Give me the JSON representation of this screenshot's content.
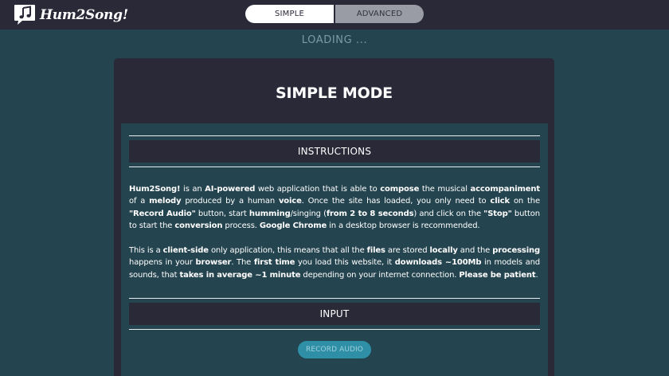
{
  "header": {
    "logo_text": "Hum2Song!",
    "tabs": [
      "SIMPLE",
      "ADVANCED"
    ],
    "active_tab": "SIMPLE"
  },
  "status": {
    "loading_text": "LOADING ..."
  },
  "card": {
    "title": "SIMPLE MODE",
    "instructions_heading": "INSTRUCTIONS",
    "paragraph1": [
      {
        "t": "Hum2Song!",
        "b": true
      },
      {
        "t": " is an ",
        "b": false
      },
      {
        "t": "AI-powered",
        "b": true
      },
      {
        "t": " web application that is able to ",
        "b": false
      },
      {
        "t": "compose",
        "b": true
      },
      {
        "t": " the musical ",
        "b": false
      },
      {
        "t": "accompaniment",
        "b": true
      },
      {
        "t": " of a ",
        "b": false
      },
      {
        "t": "melody",
        "b": true
      },
      {
        "t": " produced by a human ",
        "b": false
      },
      {
        "t": "voice",
        "b": true
      },
      {
        "t": ". Once the site has loaded, you only need to ",
        "b": false
      },
      {
        "t": "click",
        "b": true
      },
      {
        "t": " on the ",
        "b": false
      },
      {
        "t": "\"Record Audio\"",
        "b": true
      },
      {
        "t": " button, start ",
        "b": false
      },
      {
        "t": "humming",
        "b": true
      },
      {
        "t": "/singing (",
        "b": false
      },
      {
        "t": "from 2 to 8 seconds",
        "b": true
      },
      {
        "t": ") and click on the ",
        "b": false
      },
      {
        "t": "\"Stop\"",
        "b": true
      },
      {
        "t": " button to start the ",
        "b": false
      },
      {
        "t": "conversion",
        "b": true
      },
      {
        "t": " process. ",
        "b": false
      },
      {
        "t": "Google Chrome",
        "b": true
      },
      {
        "t": " in a desktop browser is recommended.",
        "b": false
      }
    ],
    "paragraph2": [
      {
        "t": "This is a ",
        "b": false
      },
      {
        "t": "client-side",
        "b": true
      },
      {
        "t": " only application, this means that all the ",
        "b": false
      },
      {
        "t": "files",
        "b": true
      },
      {
        "t": " are stored ",
        "b": false
      },
      {
        "t": "locally",
        "b": true
      },
      {
        "t": " and the ",
        "b": false
      },
      {
        "t": "processing",
        "b": true
      },
      {
        "t": " happens in your ",
        "b": false
      },
      {
        "t": "browser",
        "b": true
      },
      {
        "t": ". The ",
        "b": false
      },
      {
        "t": "first time",
        "b": true
      },
      {
        "t": " you load this website, it ",
        "b": false
      },
      {
        "t": "downloads ~100Mb",
        "b": true
      },
      {
        "t": " in models and sounds, that ",
        "b": false
      },
      {
        "t": "takes in average ~1 minute",
        "b": true
      },
      {
        "t": " depending on your internet connection. ",
        "b": false
      },
      {
        "t": "Please be patient",
        "b": true
      },
      {
        "t": ".",
        "b": false
      }
    ],
    "input_heading": "INPUT",
    "record_button_label": "RECORD AUDIO"
  },
  "colors": {
    "background": "#24444f",
    "topbar": "#2a2938",
    "card": "#2a2938",
    "accent_button": "#2e8fa6",
    "loading_text": "#7e9aa6"
  },
  "icons": {
    "logo": "music-note-speech-bubble-icon"
  }
}
